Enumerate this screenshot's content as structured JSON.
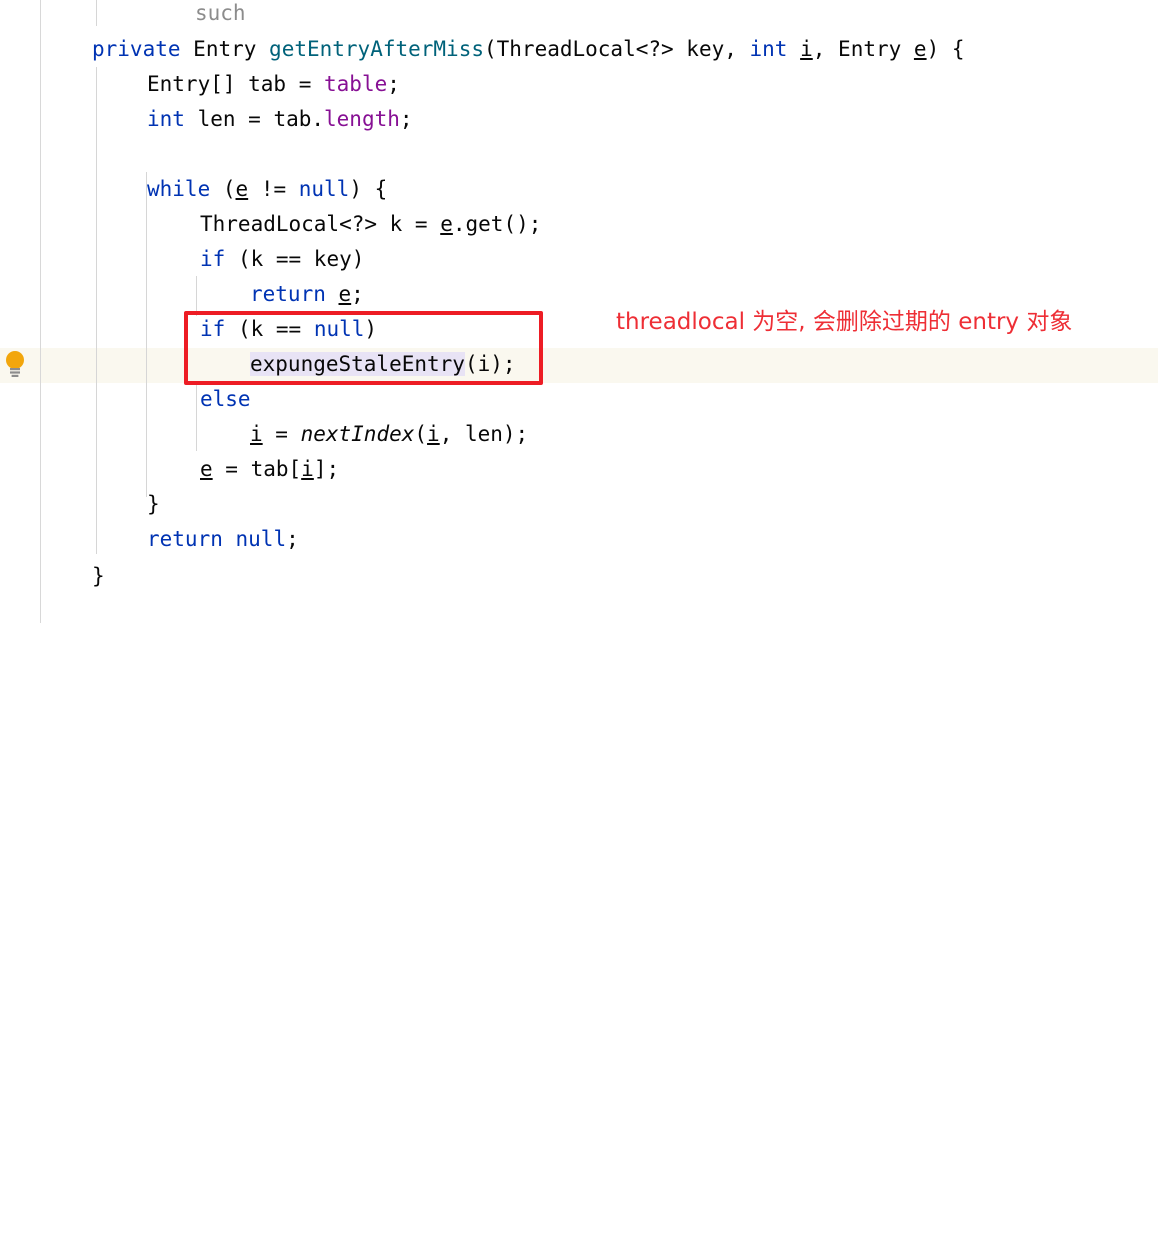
{
  "editor": {
    "app": "code-editor",
    "theme": "IntelliJ Light",
    "language": "Java",
    "colors": {
      "background": "#ffffff",
      "foreground": "#080808",
      "keyword": "#0033b3",
      "method_declaration": "#00627a",
      "field": "#871094",
      "comment": "#8c8c8c",
      "current_line_highlight": "#faf8ef",
      "identifier_highlight": "#e8e3f5",
      "gutter_rule": "#d8d8d8",
      "indent_guide": "#d6d6d6",
      "annotation_box": "#ed1c24",
      "annotation_text": "#ee2e35",
      "bulb_body": "#f2a60c",
      "bulb_base": "#8c8c8c"
    },
    "gutter": {
      "intention_bulb": "lightbulb-icon"
    },
    "lines": [
      {
        "n": 1,
        "indent": 0,
        "text": "such"
      },
      {
        "n": 2,
        "indent": 0,
        "text": "private Entry getEntryAfterMiss(ThreadLocal<?> key, int i, Entry e) {"
      },
      {
        "n": 3,
        "indent": 0,
        "text": "Entry[] tab = table;"
      },
      {
        "n": 4,
        "indent": 0,
        "text": "int len = tab.length;"
      },
      {
        "n": 5,
        "indent": 0,
        "text": ""
      },
      {
        "n": 6,
        "indent": 0,
        "text": "while (e != null) {"
      },
      {
        "n": 7,
        "indent": 0,
        "text": "ThreadLocal<?> k = e.get();"
      },
      {
        "n": 8,
        "indent": 0,
        "text": "if (k == key)"
      },
      {
        "n": 9,
        "indent": 0,
        "text": "return e;"
      },
      {
        "n": 10,
        "indent": 0,
        "text": "if (k == null)"
      },
      {
        "n": 11,
        "indent": 0,
        "text": "expungeStaleEntry(i);"
      },
      {
        "n": 12,
        "indent": 0,
        "text": "else"
      },
      {
        "n": 13,
        "indent": 0,
        "text": "i = nextIndex(i, len);"
      },
      {
        "n": 14,
        "indent": 0,
        "text": "e = tab[i];"
      },
      {
        "n": 15,
        "indent": 0,
        "text": "}"
      },
      {
        "n": 16,
        "indent": 0,
        "text": "return null;"
      },
      {
        "n": 17,
        "indent": 0,
        "text": "}"
      }
    ],
    "tokens": {
      "comment_tail": "such",
      "kw_private": "private",
      "type_entry": "Entry",
      "method_name": "getEntryAfterMiss",
      "sig_open": "(",
      "type_threadlocal": "ThreadLocal<?>",
      "param_key": " key, ",
      "kw_int": "int",
      "param_i": "i",
      "comma_entry": ", Entry ",
      "param_e": "e",
      "sig_close": ") {",
      "l3_a": "Entry[] tab = ",
      "l3_field": "table",
      "l3_b": ";",
      "l4_kw": "int",
      "l4_a": " len = tab.",
      "l4_field": "length",
      "l4_b": ";",
      "kw_while": "while",
      "while_a": " (",
      "while_e": "e",
      "while_b": " != ",
      "kw_null1": "null",
      "while_c": ") {",
      "l7_a": "ThreadLocal<?> k = ",
      "l7_e": "e",
      "l7_b": ".get();",
      "kw_if1": "if",
      "if1_rest": " (k == key)",
      "kw_return1": "return",
      "return1_e": "e",
      "return1_semi": ";",
      "kw_if2": "if",
      "if2_a": " (k == ",
      "kw_null2": "null",
      "if2_b": ")",
      "call_expunge": "expungeStaleEntry",
      "call_expunge_args": "(i);",
      "kw_else": "else",
      "l13_i1": "i",
      "l13_a": " = ",
      "l13_static": "nextIndex",
      "l13_b": "(",
      "l13_i2": "i",
      "l13_c": ", len);",
      "l14_e": "e",
      "l14_a": " = tab[",
      "l14_i": "i",
      "l14_b": "];",
      "brace_close_inner": "}",
      "kw_return2": "return",
      "return2_a": " ",
      "kw_null3": "null",
      "return2_semi": ";",
      "brace_close_outer": "}"
    }
  },
  "annotation": {
    "note_text": "threadlocal 为空, 会删除过期的 entry 对象",
    "highlight_box_target": "expungeStaleEntry-block"
  }
}
